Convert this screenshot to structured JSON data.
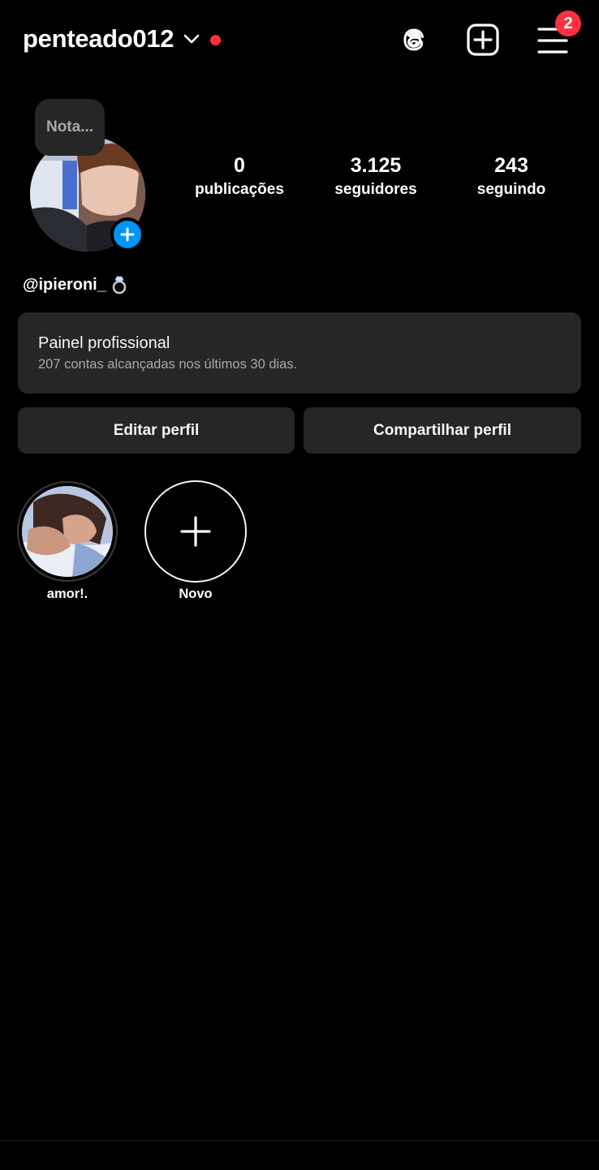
{
  "header": {
    "username": "penteado012",
    "notification_count": "2",
    "icons": [
      "chevron-down-icon",
      "threads-icon",
      "create-post-icon",
      "menu-icon"
    ],
    "live_dot_color": "#ff3040"
  },
  "profile": {
    "note": "Nota...",
    "stats": {
      "posts": {
        "value": "0",
        "label": "publicações"
      },
      "followers": {
        "value": "3.125",
        "label": "seguidores"
      },
      "following": {
        "value": "243",
        "label": "seguindo"
      }
    },
    "bio": "@ipieroni_",
    "bio_emoji": "ring-icon"
  },
  "dashboard": {
    "title": "Painel profissional",
    "subtitle": "207 contas alcançadas nos últimos 30 dias."
  },
  "actions": {
    "edit_label": "Editar perfil",
    "share_label": "Compartilhar perfil"
  },
  "highlights": [
    {
      "label": "amor!."
    },
    {
      "label": "Novo"
    }
  ],
  "colors": {
    "background": "#000000",
    "surface": "#262626",
    "accent_blue": "#0095f6",
    "badge_red": "#ff3040"
  }
}
